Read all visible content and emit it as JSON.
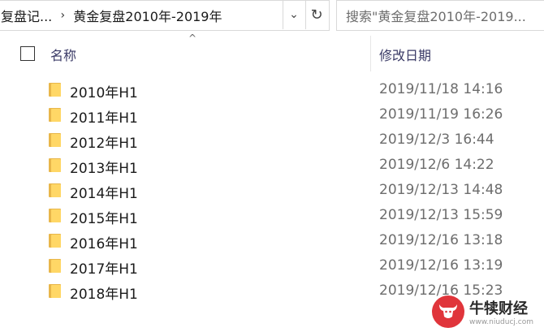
{
  "address_bar": {
    "root_label": "复盘记...",
    "separator": "›",
    "current_folder": "黄金复盘2010年-2019年",
    "dropdown_glyph": "⌄",
    "refresh_glyph": "↻"
  },
  "search": {
    "placeholder": "搜索\"黄金复盘2010年-2019..."
  },
  "columns": {
    "name": "名称",
    "date_modified": "修改日期",
    "sort_indicator": "^"
  },
  "files": [
    {
      "name": "2010年H1",
      "date": "2019/11/18 14:16"
    },
    {
      "name": "2011年H1",
      "date": "2019/11/19 16:26"
    },
    {
      "name": "2012年H1",
      "date": "2019/12/3 16:44"
    },
    {
      "name": "2013年H1",
      "date": "2019/12/6 14:22"
    },
    {
      "name": "2014年H1",
      "date": "2019/12/13 14:48"
    },
    {
      "name": "2015年H1",
      "date": "2019/12/13 15:59"
    },
    {
      "name": "2016年H1",
      "date": "2019/12/16 13:18"
    },
    {
      "name": "2017年H1",
      "date": "2019/12/16 13:19"
    },
    {
      "name": "2018年H1",
      "date": "2019/12/16 15:23"
    }
  ],
  "watermark": {
    "title": "牛犊财经",
    "subtitle": "www.niuducj.com"
  },
  "icons": {
    "folder": "folder-icon",
    "logo": "bull-logo-icon"
  },
  "colors": {
    "folder_front": "#ffd766",
    "folder_back": "#e8b64a",
    "header_text": "#3a3a66",
    "date_text": "#6d6d6d",
    "logo_red": "#e0353b"
  }
}
